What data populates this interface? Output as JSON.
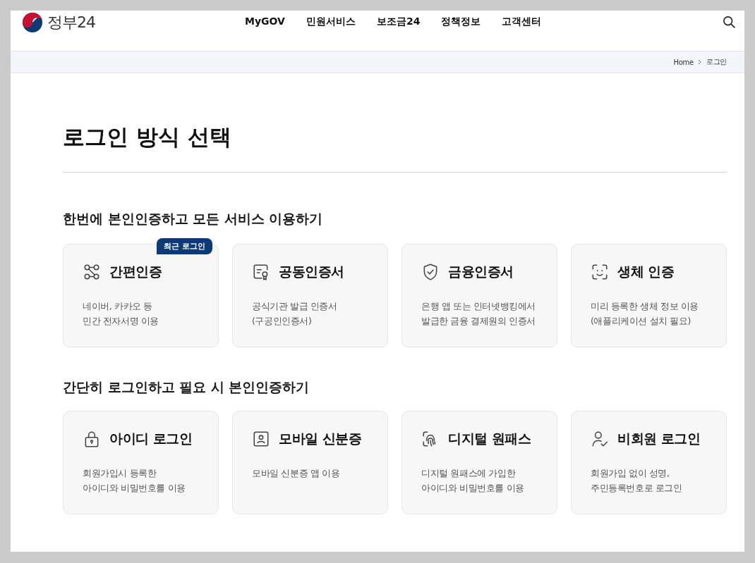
{
  "header": {
    "logo": "정부24",
    "nav": [
      "MyGOV",
      "민원서비스",
      "보조금24",
      "정책정보",
      "고객센터"
    ]
  },
  "breadcrumb": [
    "Home",
    "로그인"
  ],
  "title": "로그인 방식 선택",
  "sections": [
    {
      "heading": "한번에 본인인증하고 모든 서비스 이용하기",
      "cards": [
        {
          "title": "간편인증",
          "lines": [
            "네이버, 카카오 등",
            "민간 전자서명 이용"
          ],
          "badge": "최근 로그인"
        },
        {
          "title": "공동인증서",
          "lines": [
            "공식기관 발급 인증서",
            "(구공인인증서)"
          ]
        },
        {
          "title": "금융인증서",
          "lines": [
            "은행 앱 또는 인터넷뱅킹에서",
            "발급한 금융 결제원의 인증서"
          ]
        },
        {
          "title": "생체 인증",
          "lines": [
            "미리 등록한 생체 정보 이용",
            "(애플리케이션 설치 필요)"
          ]
        }
      ]
    },
    {
      "heading": "간단히 로그인하고 필요 시 본인인증하기",
      "cards": [
        {
          "title": "아이디 로그인",
          "lines": [
            "회원가입시 등록한",
            "아이디와 비밀번호를 이용"
          ]
        },
        {
          "title": "모바일 신분증",
          "lines": [
            "모바일 신분증 앱 이용"
          ]
        },
        {
          "title": "디지털 원패스",
          "lines": [
            "디지털 원패스에 가입한",
            "아이디와 비밀번호를 이용"
          ]
        },
        {
          "title": "비회원 로그인",
          "lines": [
            "회원가입 없이 성명,",
            "주민등록번호로 로그인"
          ]
        }
      ]
    }
  ]
}
